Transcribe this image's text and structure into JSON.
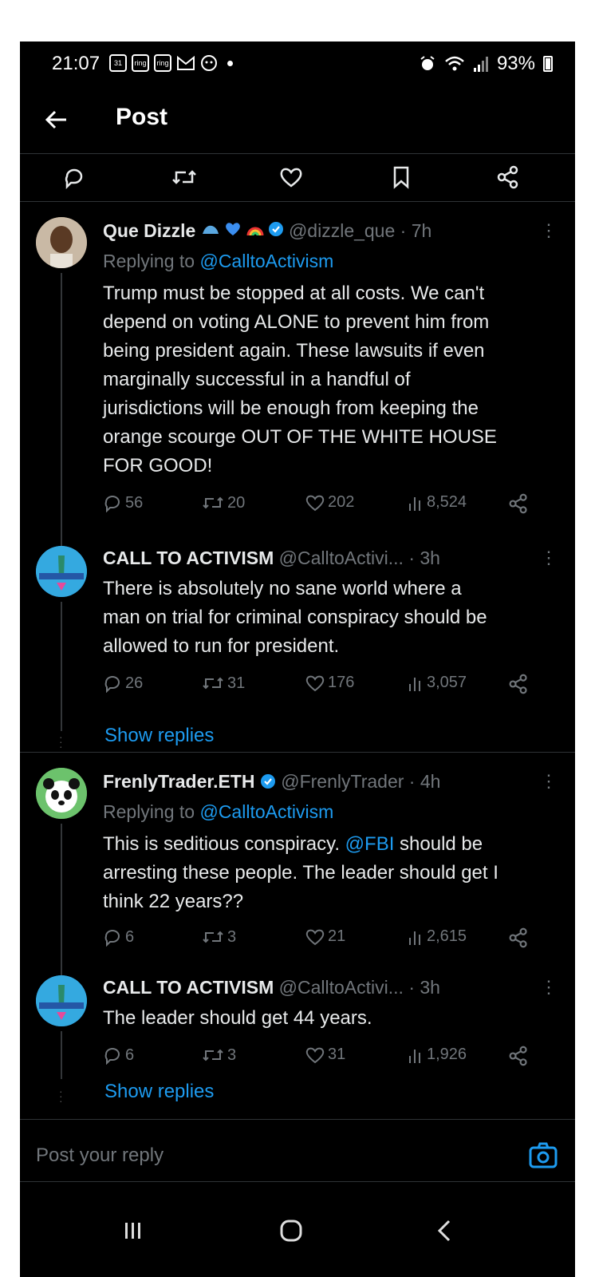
{
  "status_bar": {
    "time": "21:07",
    "notif_icons": [
      "31",
      "ring",
      "ring"
    ],
    "battery": "93%"
  },
  "header": {
    "title": "Post"
  },
  "tweets": [
    {
      "name": "Que Dizzle",
      "handle": "@dizzle_que",
      "time": "· 7h",
      "replying_prefix": "Replying to",
      "replying_to": "@CalltoActivism",
      "body": "Trump must be stopped at all costs.  We can't\ndepend on voting  ALONE to prevent him from\nbeing president again.  These lawsuits if even\nmarginally successful in a handful of\njurisdictions will be enough from keeping the\norange scourge OUT OF THE WHITE HOUSE\nFOR GOOD!",
      "replies": "56",
      "reposts": "20",
      "likes": "202",
      "views": "8,524"
    },
    {
      "name": "CALL TO ACTIVISM",
      "handle": "@CalltoActivi...",
      "time": "· 3h",
      "body": "There is absolutely no sane world where a\nman on trial for criminal conspiracy should be\nallowed to run for president.",
      "replies": "26",
      "reposts": "31",
      "likes": "176",
      "views": "3,057",
      "show_replies": "Show replies"
    },
    {
      "name": "FrenlyTrader.ETH",
      "handle": "@FrenlyTrader",
      "time": "· 4h",
      "replying_prefix": "Replying to",
      "replying_to": "@CalltoActivism",
      "body_a": "This is seditious conspiracy. ",
      "body_mention": "@FBI",
      "body_b": " should be\narresting these people. The leader should get I\nthink 22 years??",
      "replies": "6",
      "reposts": "3",
      "likes": "21",
      "views": "2,615"
    },
    {
      "name": "CALL TO ACTIVISM",
      "handle": "@CalltoActivi...",
      "time": "· 3h",
      "body": "The leader should get 44 years.",
      "replies": "6",
      "reposts": "3",
      "likes": "31",
      "views": "1,926",
      "show_replies": "Show replies"
    }
  ],
  "reply_box": {
    "placeholder": "Post your reply"
  },
  "colors": {
    "background": "#000000",
    "link": "#1d9bf0",
    "muted": "#71767b",
    "verified": "#1d9bf0"
  }
}
